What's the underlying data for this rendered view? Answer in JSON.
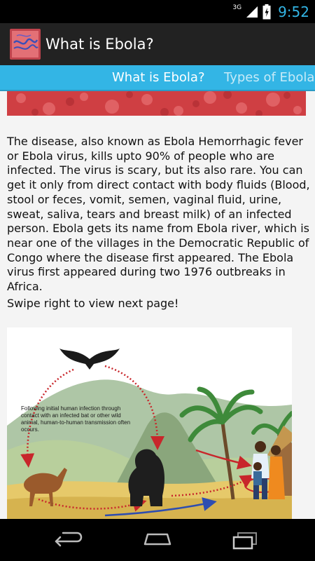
{
  "status_bar": {
    "network_label": "3G",
    "time": "9:52"
  },
  "action_bar": {
    "title": "What is Ebola?",
    "icon": "ebola-app-icon"
  },
  "tabs": [
    {
      "label": "What is Ebola?",
      "active": true
    },
    {
      "label": "Types of Ebola",
      "active": false
    }
  ],
  "content": {
    "description": "The disease, also known as Ebola Hemorrhagic fever or Ebola virus, kills upto 90% of people who are infected. The virus is scary, but its also rare. You can get it only from direct contact with body fluids (Blood, stool or feces, vomit, semen, vaginal fluid, urine, sweat, saliva, tears and breast milk) of an infected person. Ebola gets its name from Ebola river, which is near one of the villages in the Democratic Republic of Congo where the disease first appeared. The Ebola virus first appeared during two 1976 outbreaks in Africa.",
    "swipe_hint": "Swipe right to view next page!",
    "illustration_caption": "Following initial human infection through contact with an infected bat or other wild animal, human-to-human transmission often occurs."
  },
  "colors": {
    "accent": "#33b5e5",
    "action_bar": "#222222",
    "content_bg": "#f4f4f4"
  },
  "nav_bar": {
    "back_icon": "back-icon",
    "home_icon": "home-icon",
    "recents_icon": "recents-icon"
  }
}
